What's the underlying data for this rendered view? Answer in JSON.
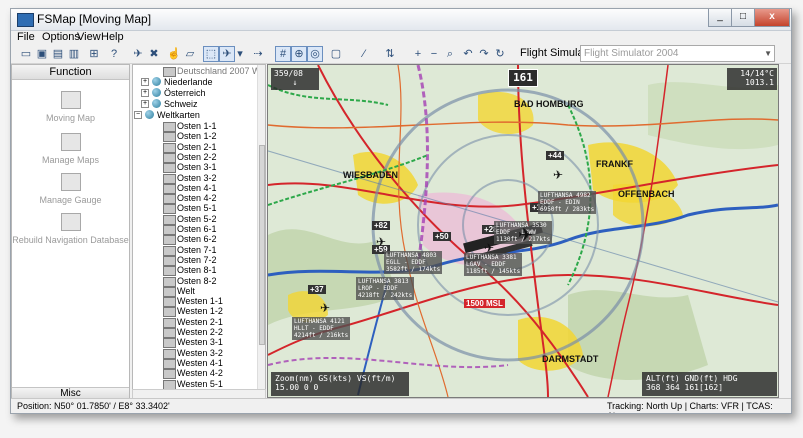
{
  "window": {
    "title": "FSMap [Moving Map]",
    "btn_min": "_",
    "btn_max": "□",
    "btn_close": "x"
  },
  "menu": [
    "File",
    "Options",
    "View",
    "Help"
  ],
  "toolbar": {
    "flight_simulator_label": "Flight Simulator",
    "flight_simulator_value": "Flight Simulator 2004"
  },
  "function_panel": {
    "header": "Function",
    "items": [
      "Moving Map",
      "Manage Maps",
      "Manage Gauge",
      "Rebuild Navigation Database"
    ],
    "footer": "Misc"
  },
  "tree": {
    "top": "Deutschland 2007 W",
    "groups": [
      "Niederlande",
      "Österreich",
      "Schweiz",
      "Weltkarten"
    ],
    "items": [
      "Osten 1-1",
      "Osten 1-2",
      "Osten 2-1",
      "Osten 2-2",
      "Osten 3-1",
      "Osten 3-2",
      "Osten 4-1",
      "Osten 4-2",
      "Osten 5-1",
      "Osten 5-2",
      "Osten 6-1",
      "Osten 6-2",
      "Osten 7-1",
      "Osten 7-2",
      "Osten 8-1",
      "Osten 8-2",
      "Welt",
      "Westen 1-1",
      "Westen 1-2",
      "Westen 2-1",
      "Westen 2-2",
      "Westen 3-1",
      "Westen 3-2",
      "Westen 4-1",
      "Westen 4-2",
      "Westen 5-1"
    ]
  },
  "map": {
    "wind": "359/08",
    "wind_arrow": "↓",
    "speed": "161",
    "temp": "14/14°C",
    "pressure": "1013.1",
    "bottom_left_labels": "Zoom(nm) GS(kts) VS(ft/m)",
    "bottom_left_values": "15.00   0      0",
    "bottom_right_labels": "ALT(ft)  GND(ft)   HDG",
    "bottom_right_values": "368      364   161[162]",
    "cities": [
      "WIESBADEN",
      "FRANKF",
      "OFFENBACH",
      "DARMSTADT",
      "BAD HOMBURG"
    ],
    "labels": [
      "+44",
      "+82",
      "+50",
      "+59",
      "+37",
      "+28",
      "+10",
      "1500 MSL"
    ],
    "traffic": [
      {
        "l1": "LUFTHANSA 4982",
        "l2": "EDDF - EDIN",
        "l3": "6950ft / 283kts"
      },
      {
        "l1": "LUFTHANSA 3530",
        "l2": "EDDF - LOWW",
        "l3": "1130ft / 217kts"
      },
      {
        "l1": "LUFTHANSA 3381",
        "l2": "LGAV - EDDF",
        "l3": "1185ft / 145kts"
      },
      {
        "l1": "LUFTHANSA 4803",
        "l2": "EGLL - EDDF",
        "l3": "3582ft / 174kts"
      },
      {
        "l1": "LUFTHANSA 3813",
        "l2": "LROP - EDDF",
        "l3": "4218ft / 242kts"
      },
      {
        "l1": "LUFTHANSA 4121",
        "l2": "HLLT - EDDF",
        "l3": "4214ft / 216kts"
      }
    ]
  },
  "status": {
    "position": "Position: N50° 01.7850' / E8° 33.3402'",
    "right": "Tracking: North Up | Charts: VFR | TCAS: Above"
  },
  "colors": {
    "road": "#d4252b",
    "water": "#2d5fbf",
    "airspace": "#7a8fa8",
    "urban": "#f2d632"
  }
}
